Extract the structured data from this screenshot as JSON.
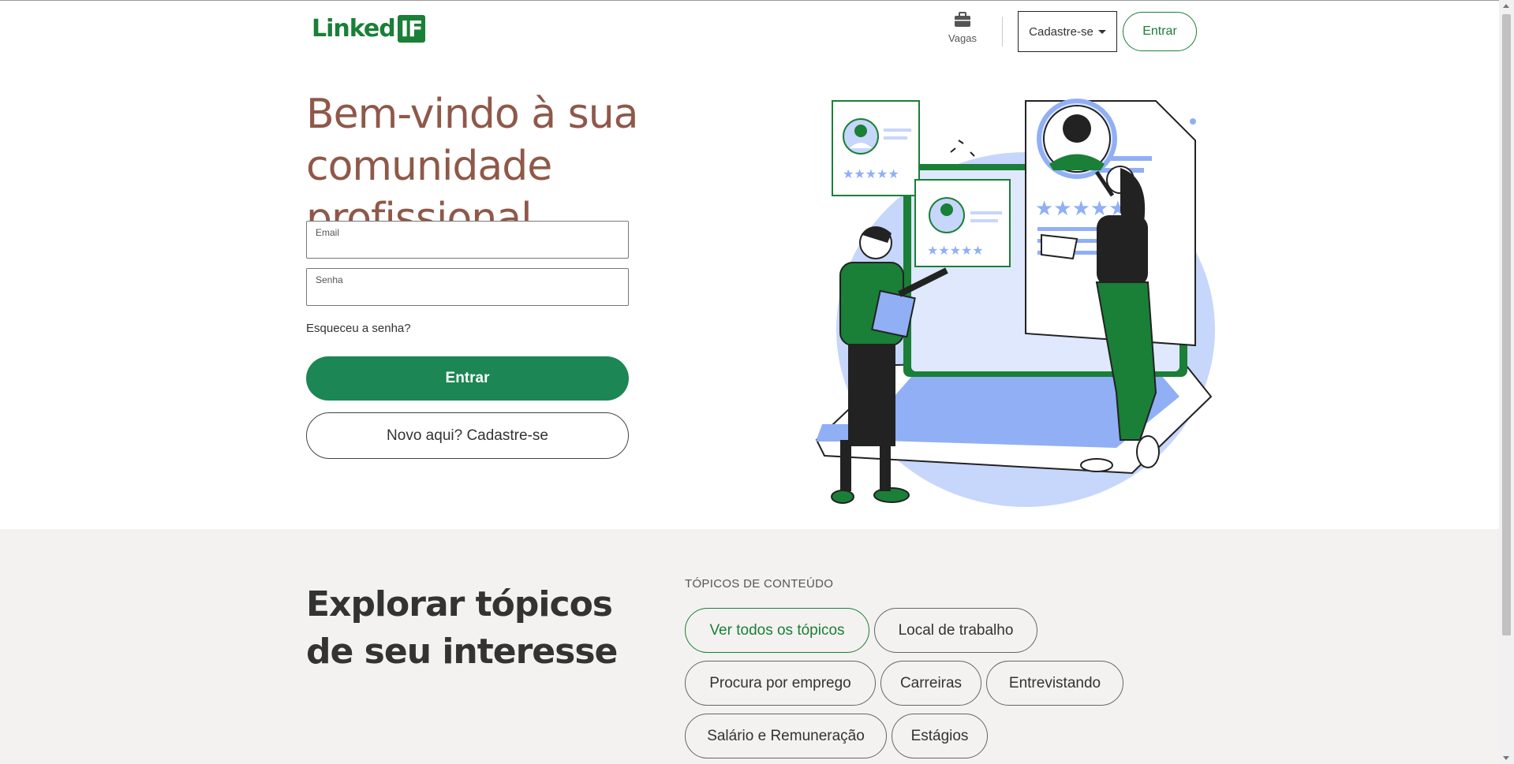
{
  "brand": {
    "name": "Linked",
    "suffix": "IF",
    "color": "#1a7f37"
  },
  "nav": {
    "jobs_label": "Vagas",
    "jobs_icon": "briefcase-icon",
    "signup_dropdown_label": "Cadastre-se",
    "login_label": "Entrar"
  },
  "hero": {
    "title": "Bem-vindo à sua comunidade profissional",
    "email_label": "Email",
    "email_value": "",
    "password_label": "Senha",
    "password_value": "",
    "forgot_password": "Esqueceu a senha?",
    "submit_label": "Entrar",
    "signup_label": "Novo aqui? Cadastre-se",
    "illustration": "hiring-illustration"
  },
  "explore": {
    "title": "Explorar tópicos de seu interesse",
    "topics_heading": "TÓPICOS DE CONTEÚDO",
    "topics": [
      {
        "label": "Ver todos os tópicos",
        "active": true
      },
      {
        "label": "Local de trabalho",
        "active": false
      },
      {
        "label": "Procura por emprego",
        "active": false
      },
      {
        "label": "Carreiras",
        "active": false
      },
      {
        "label": "Entrevistando",
        "active": false
      },
      {
        "label": "Salário e Remuneração",
        "active": false
      },
      {
        "label": "Estágios",
        "active": false
      }
    ]
  },
  "colors": {
    "primary": "#1c8655",
    "title": "#8f5849",
    "section_bg": "#f3f2f0",
    "illustration_blue": "#c7d6fb"
  }
}
